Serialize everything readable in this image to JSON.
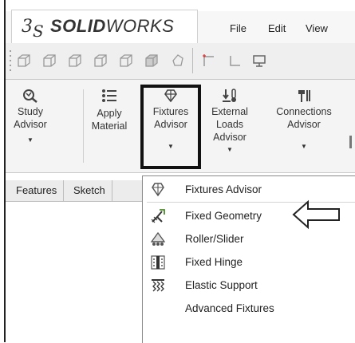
{
  "app": {
    "brand_bold": "SOLID",
    "brand_light": "WORKS",
    "logo_mark": "3S"
  },
  "menu": [
    "File",
    "Edit",
    "View"
  ],
  "quickbar_icons": [
    "cube-icon",
    "cube-icon",
    "cube-icon",
    "cube-icon",
    "cube-icon",
    "cube-icon",
    "shape-icon",
    "sketch-icon",
    "rectangle-icon",
    "monitor-icon"
  ],
  "ribbon": {
    "study_advisor": [
      "Study",
      "Advisor"
    ],
    "apply_material": [
      "Apply",
      "Material"
    ],
    "fixtures_advisor": [
      "Fixtures",
      "Advisor"
    ],
    "external_loads": [
      "External",
      "Loads",
      "Advisor"
    ],
    "connections": [
      "Connections",
      "Advisor"
    ]
  },
  "tabs": [
    "Features",
    "Sketch"
  ],
  "dropdown": {
    "header": "Fixtures Advisor",
    "items": [
      "Fixed Geometry",
      "Roller/Slider",
      "Fixed Hinge",
      "Elastic Support",
      "Advanced Fixtures"
    ]
  }
}
